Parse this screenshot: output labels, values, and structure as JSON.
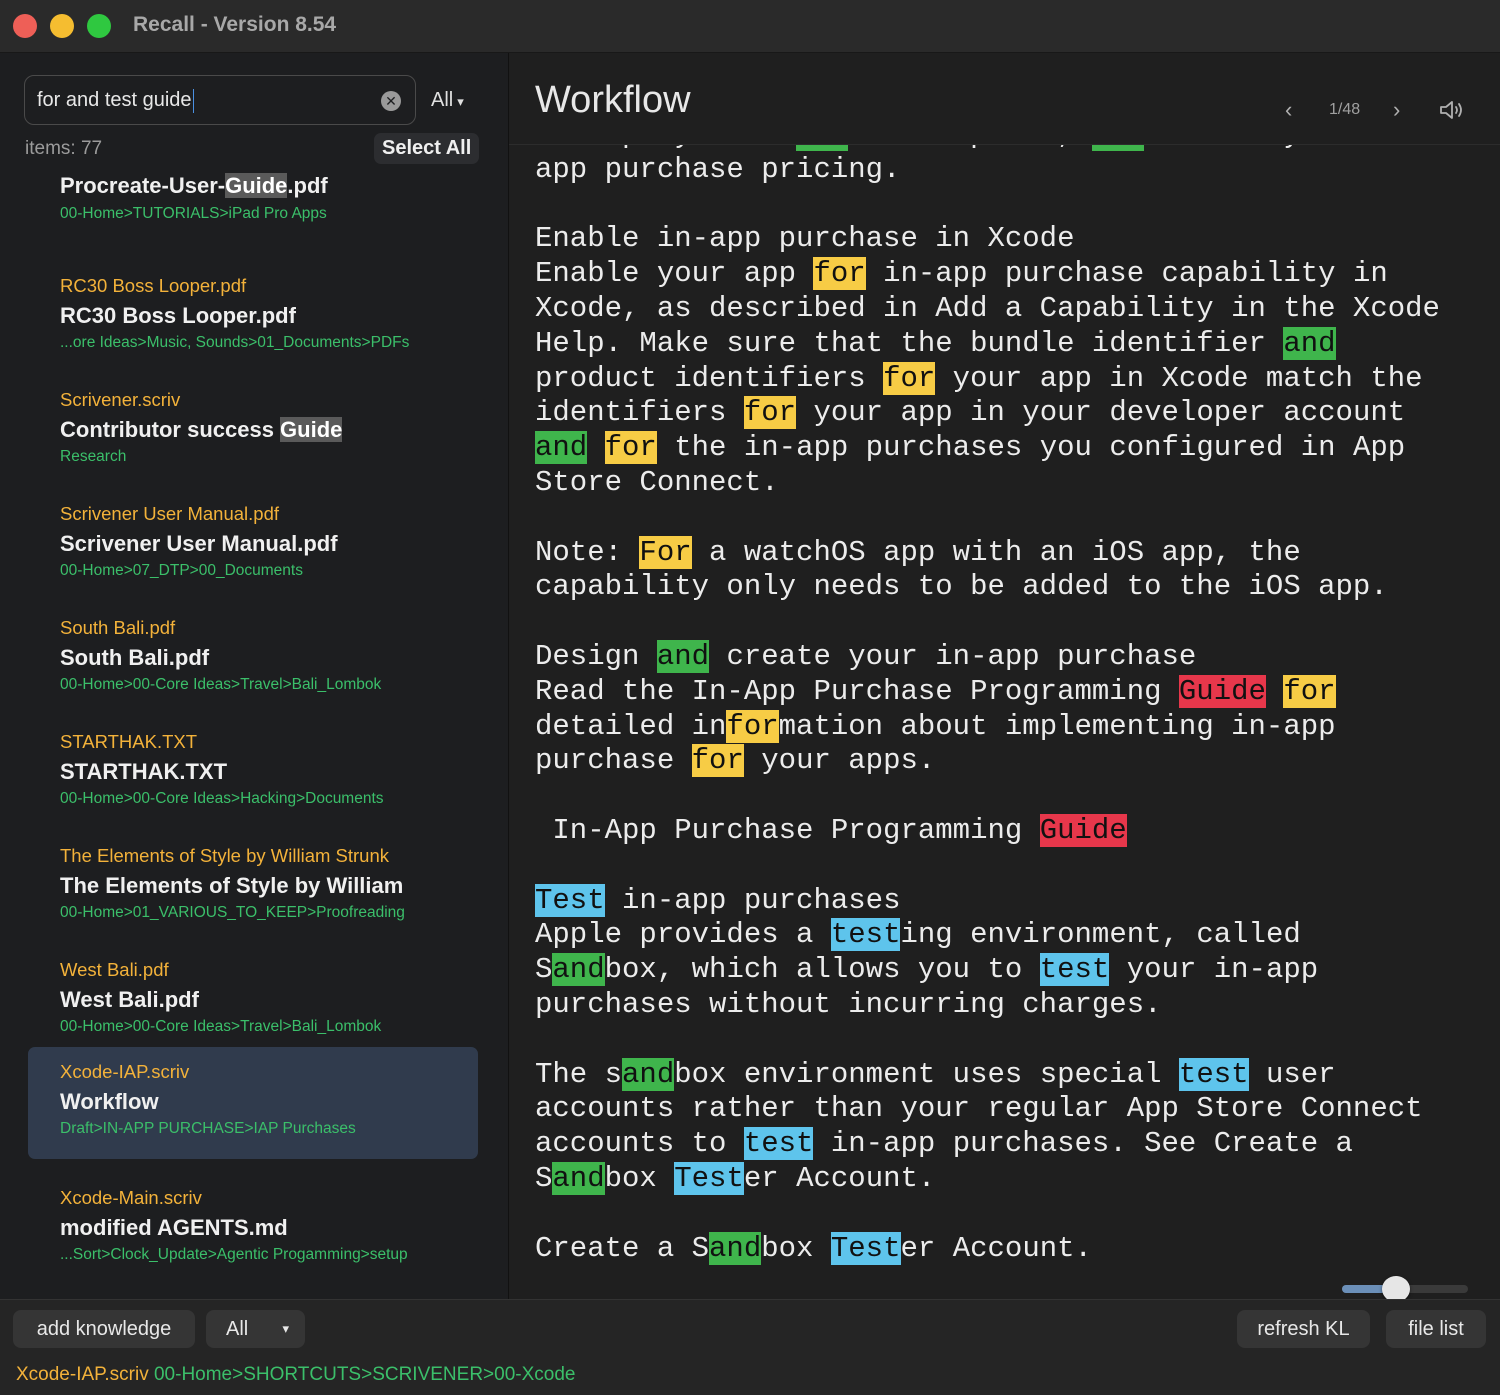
{
  "window": {
    "title": "Recall - Version 8.54"
  },
  "search": {
    "query": "for and test guide",
    "scope": "All"
  },
  "list_header": {
    "items_count": "items: 77",
    "select_all": "Select All"
  },
  "results": [
    {
      "file": "",
      "name_pre": "Procreate-User-",
      "name_hl": "Guide",
      "name_post": ".pdf",
      "path": "00-Home>TUTORIALS>iPad Pro Apps"
    },
    {
      "file": "RC30 Boss Looper.pdf",
      "name_pre": "RC30 Boss Looper.pdf",
      "name_hl": "",
      "name_post": "",
      "path": "...ore Ideas>Music, Sounds>01_Documents>PDFs"
    },
    {
      "file": "Scrivener.scriv",
      "name_pre": "Contributor success ",
      "name_hl": "Guide",
      "name_post": "",
      "path": "Research"
    },
    {
      "file": "Scrivener User Manual.pdf",
      "name_pre": "Scrivener User Manual.pdf",
      "name_hl": "",
      "name_post": "",
      "path": "00-Home>07_DTP>00_Documents"
    },
    {
      "file": "South Bali.pdf",
      "name_pre": "South Bali.pdf",
      "name_hl": "",
      "name_post": "",
      "path": "00-Home>00-Core Ideas>Travel>Bali_Lombok"
    },
    {
      "file": "STARTHAK.TXT",
      "name_pre": "STARTHAK.TXT",
      "name_hl": "",
      "name_post": "",
      "path": "00-Home>00-Core Ideas>Hacking>Documents"
    },
    {
      "file": "The Elements of Style by William Strunk",
      "name_pre": "The Elements of Style by William",
      "name_hl": "",
      "name_post": "",
      "path": "00-Home>01_VARIOUS_TO_KEEP>Proofreading"
    },
    {
      "file": "West Bali.pdf",
      "name_pre": "West Bali.pdf",
      "name_hl": "",
      "name_post": "",
      "path": "00-Home>00-Core Ideas>Travel>Bali_Lombok"
    },
    {
      "file": "Xcode-IAP.scriv",
      "name_pre": "Workflow",
      "name_hl": "",
      "name_post": "",
      "path": "Draft>IN-APP PURCHASE>IAP Purchases",
      "selected": true
    },
    {
      "file": "Xcode-Main.scriv",
      "name_pre": "modified AGENTS.md",
      "name_hl": "",
      "name_post": "",
      "path": "...Sort>Clock_Update>Agentic Progamming>setup"
    }
  ],
  "viewer": {
    "title": "Workflow",
    "page": "1/48",
    "zoom_fraction": 0.43,
    "lines": [
      [
        [
          "a display name ",
          ""
        ],
        [
          "and",
          "g"
        ],
        [
          " description, ",
          ""
        ],
        [
          "and",
          "g"
        ],
        [
          " choose your in-",
          ""
        ]
      ],
      [
        [
          "app purchase pricing.",
          ""
        ]
      ],
      [],
      [
        [
          "Enable in-app purchase in Xcode",
          ""
        ]
      ],
      [
        [
          "Enable your app ",
          ""
        ],
        [
          "for",
          "y"
        ],
        [
          " in-app purchase capability in",
          ""
        ]
      ],
      [
        [
          "Xcode, as described in Add a Capability in the Xcode",
          ""
        ]
      ],
      [
        [
          "Help. Make sure that the bundle identifier ",
          ""
        ],
        [
          "and",
          "g"
        ]
      ],
      [
        [
          "product identifiers ",
          ""
        ],
        [
          "for",
          "y"
        ],
        [
          " your app in Xcode match the",
          ""
        ]
      ],
      [
        [
          "identifiers ",
          ""
        ],
        [
          "for",
          "y"
        ],
        [
          " your app in your developer account",
          ""
        ]
      ],
      [
        [
          "and",
          "g"
        ],
        [
          " ",
          ""
        ],
        [
          "for",
          "y"
        ],
        [
          " the in-app purchases you configured in App",
          ""
        ]
      ],
      [
        [
          "Store Connect.",
          ""
        ]
      ],
      [],
      [
        [
          "Note: ",
          ""
        ],
        [
          "For",
          "y"
        ],
        [
          " a watchOS app with an iOS app, the",
          ""
        ]
      ],
      [
        [
          "capability only needs to be added to the iOS app.",
          ""
        ]
      ],
      [],
      [
        [
          "Design ",
          ""
        ],
        [
          "and",
          "g"
        ],
        [
          " create your in-app purchase",
          ""
        ]
      ],
      [
        [
          "Read the In-App Purchase Programming ",
          ""
        ],
        [
          "Guide",
          "r"
        ],
        [
          " ",
          ""
        ],
        [
          "for",
          "y"
        ]
      ],
      [
        [
          "detailed in",
          ""
        ],
        [
          "for",
          "y"
        ],
        [
          "mation about implementing in-app",
          ""
        ]
      ],
      [
        [
          "purchase ",
          ""
        ],
        [
          "for",
          "y"
        ],
        [
          " your apps.",
          ""
        ]
      ],
      [],
      [
        [
          " In-App Purchase Programming ",
          ""
        ],
        [
          "Guide",
          "r"
        ]
      ],
      [],
      [
        [
          "Test",
          "b"
        ],
        [
          " in-app purchases",
          ""
        ]
      ],
      [
        [
          "Apple provides a ",
          ""
        ],
        [
          "test",
          "b"
        ],
        [
          "ing environment, called",
          ""
        ]
      ],
      [
        [
          "S",
          ""
        ],
        [
          "and",
          "g"
        ],
        [
          "box, which allows you to ",
          ""
        ],
        [
          "test",
          "b"
        ],
        [
          " your in-app",
          ""
        ]
      ],
      [
        [
          "purchases without incurring charges.",
          ""
        ]
      ],
      [],
      [
        [
          "The s",
          ""
        ],
        [
          "and",
          "g"
        ],
        [
          "box environment uses special ",
          ""
        ],
        [
          "test",
          "b"
        ],
        [
          " user",
          ""
        ]
      ],
      [
        [
          "accounts rather than your regular App Store Connect",
          ""
        ]
      ],
      [
        [
          "accounts to ",
          ""
        ],
        [
          "test",
          "b"
        ],
        [
          " in-app purchases. See Create a",
          ""
        ]
      ],
      [
        [
          "S",
          ""
        ],
        [
          "and",
          "g"
        ],
        [
          "box ",
          ""
        ],
        [
          "Test",
          "b"
        ],
        [
          "er Account.",
          ""
        ]
      ],
      [],
      [
        [
          "Create a S",
          ""
        ],
        [
          "and",
          "g"
        ],
        [
          "box ",
          ""
        ],
        [
          "Test",
          "b"
        ],
        [
          "er Account.",
          ""
        ]
      ]
    ]
  },
  "bottom": {
    "add_knowledge": "add knowledge",
    "scope": "All",
    "refresh": "refresh KL",
    "file_list": "file list",
    "status_file": "Xcode-IAP.scriv",
    "status_path": "00-Home>SHORTCUTS>SCRIVENER>00-Xcode"
  },
  "colors": {
    "file_label": "#f3b23a",
    "path_label": "#3bbf6a",
    "hl_for": "#f7cc45",
    "hl_and": "#3fb54c",
    "hl_guide": "#e7374b",
    "hl_test": "#5ec4ec",
    "selected_row": "#303b4d"
  }
}
